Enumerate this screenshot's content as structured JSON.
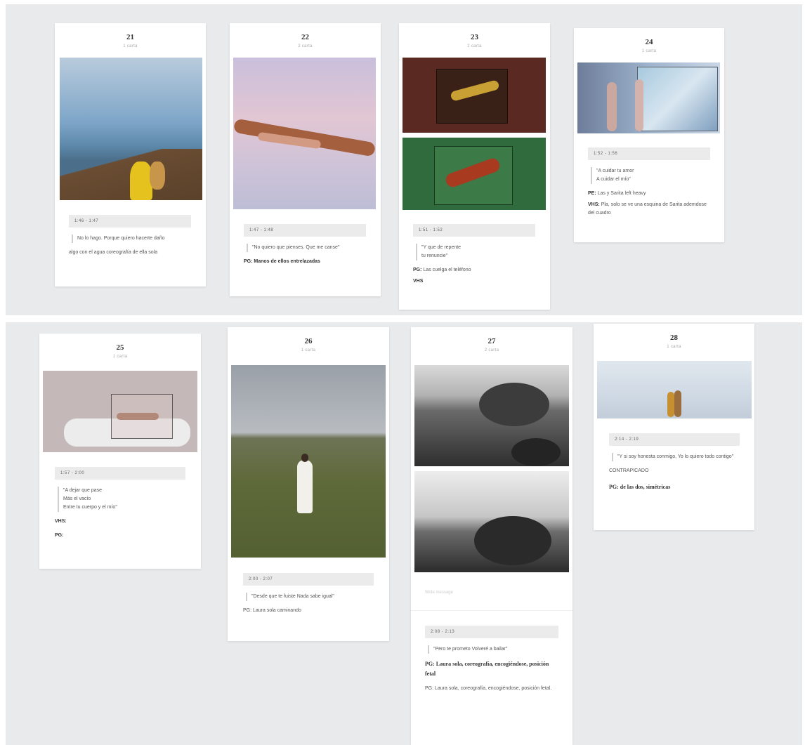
{
  "cards": [
    {
      "num": "21",
      "sub": "1 carta",
      "timecode": "1:46 - 1:47",
      "quote": "No lo hago. Porque quiero hacerte daño",
      "lines": [
        {
          "text": "algo con el agua coreografía de ella sola"
        }
      ]
    },
    {
      "num": "22",
      "sub": "2 carta",
      "timecode": "1:47 - 1:48",
      "quote": "\"No quiero que pienses. Que me canse\"",
      "lines": [
        {
          "label": "PG:",
          "text": "Manos de ellos entrelazadas"
        }
      ]
    },
    {
      "num": "23",
      "sub": "2 carta",
      "timecode": "1:51 - 1:52",
      "quote": "\"Y que de repente\ntu renuncie\"",
      "lines": [
        {
          "label": "PG:",
          "text": "Las cuelga el teléfono"
        },
        {
          "label": "VHS",
          "text": ""
        }
      ]
    },
    {
      "num": "24",
      "sub": "1 carta",
      "timecode": "1:52 - 1:56",
      "quote": "\"A cuidar tu amor\nA cuidar el mío\"",
      "lines": [
        {
          "label": "PE:",
          "text": "Las y Sarita left heavy"
        },
        {
          "label": "VHS:",
          "text": "Pla, solo se ve una esquina de Sarita ademdose del cuadro"
        }
      ]
    },
    {
      "num": "25",
      "sub": "1 carta",
      "timecode": "1:57 - 2:00",
      "quote": "\"A dejar que pase\nMás el vacío\nEntre tu cuerpo y el mío\"",
      "lines": [
        {
          "label": "VHS:",
          "text": ""
        },
        {
          "label": "PG:",
          "text": ""
        }
      ]
    },
    {
      "num": "26",
      "sub": "1 carta",
      "timecode": "2:00 - 2:07",
      "quote": "\"Desde que te fuiste Nada sabe igual\"",
      "lines": [
        {
          "text": "PG: Laura sola caminando"
        }
      ]
    },
    {
      "num": "27",
      "sub": "2 carta",
      "placeholder": "Write message",
      "timecode": "2:08 - 2:13",
      "quote": "\"Pero te prometo Volveré a bailar\"",
      "bold": "PG: Laura sola, coreografía, encogiéndose, posición fetal",
      "tail": "PG: Laura sola, coreografía, encogiéndose, posición fetal."
    },
    {
      "num": "28",
      "sub": "1 carta",
      "timecode": "2:14 - 2:19",
      "quote": "\"Y si soy honesta conmigo, Yo lo quiero todo contigo\"",
      "caps": "CONTRAPICADO",
      "bold": "PG: de las dos, simétricas"
    }
  ],
  "colors": {
    "band": "#e8eaec",
    "card": "#ffffff",
    "timecode_bg": "#ebebeb"
  }
}
